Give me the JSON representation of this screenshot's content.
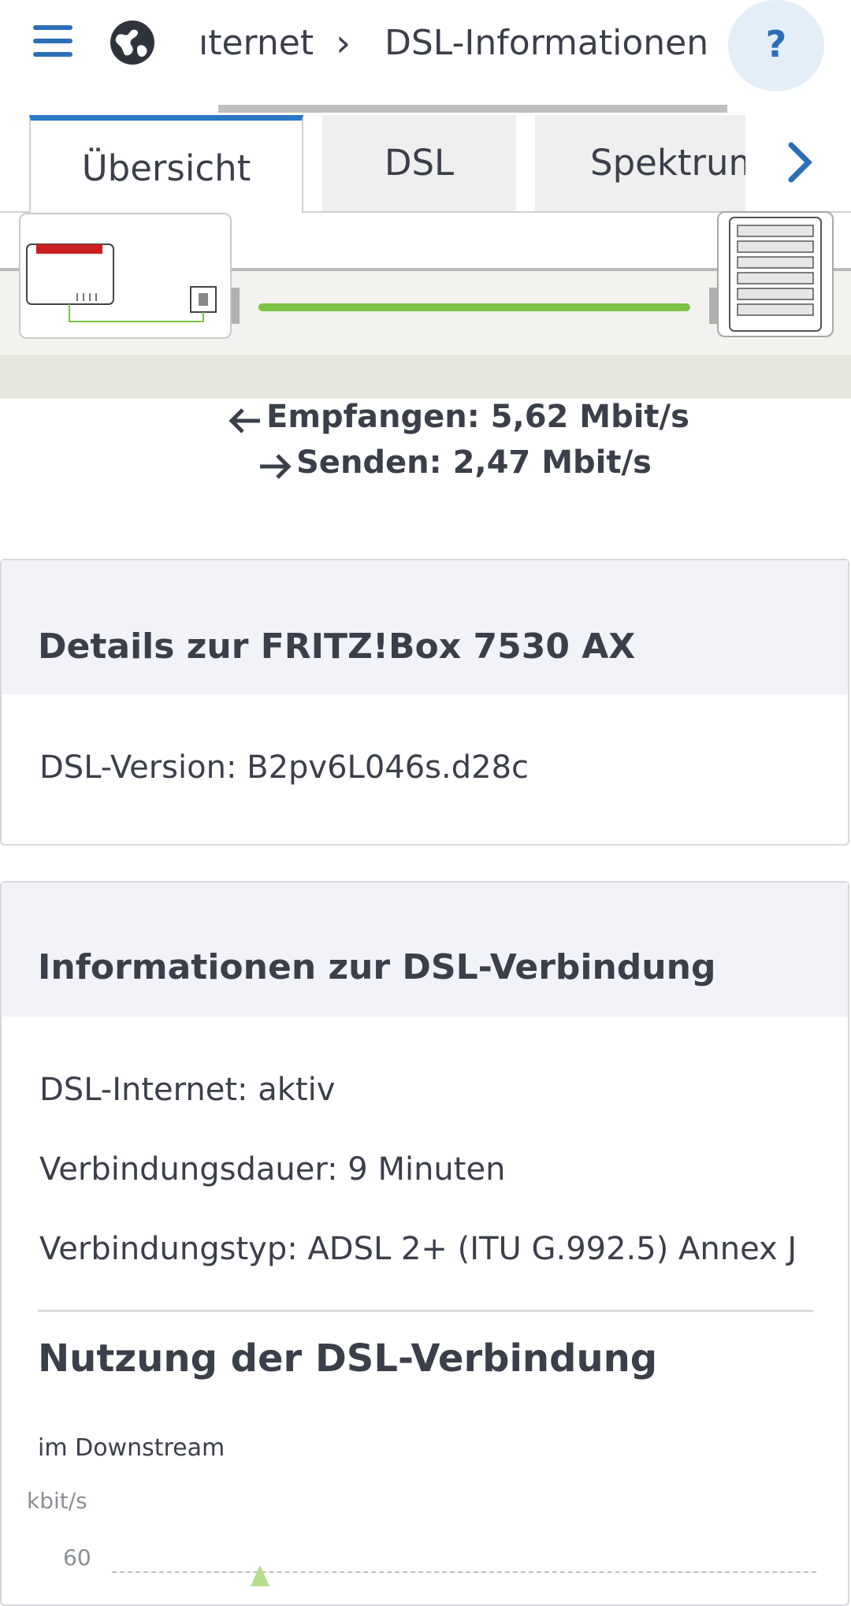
{
  "header": {
    "breadcrumb_parent": "ıternet",
    "breadcrumb_separator": "›",
    "breadcrumb_current": "DSL-Informationen",
    "help_label": "?"
  },
  "tabs": [
    {
      "label": "Übersicht",
      "active": true
    },
    {
      "label": "DSL",
      "active": false
    },
    {
      "label": "Spektrum",
      "active": false
    }
  ],
  "rates": {
    "receive": "Empfangen: 5,62 Mbit/s",
    "send": "Senden: 2,47 Mbit/s"
  },
  "details_panel": {
    "title": "Details zur FRITZ!Box 7530 AX",
    "dsl_version": "DSL-Version: B2pv6L046s.d28c"
  },
  "connection_panel": {
    "title": "Informationen zur DSL-Verbindung",
    "rows": [
      "DSL-Internet: aktiv",
      "Verbindungsdauer: 9 Minuten",
      "Verbindungstyp: ADSL 2+ (ITU G.992.5) Annex J"
    ],
    "usage_title": "Nutzung der DSL-Verbindung",
    "downstream_label": "im Downstream"
  },
  "chart_data": {
    "type": "area",
    "title": "im Downstream",
    "ylabel": "kbit/s",
    "y_ticks": [
      "60"
    ]
  },
  "colors": {
    "accent": "#2b6fb6",
    "dsl_line": "#7cc242",
    "fritz_red": "#cc1f1f"
  }
}
